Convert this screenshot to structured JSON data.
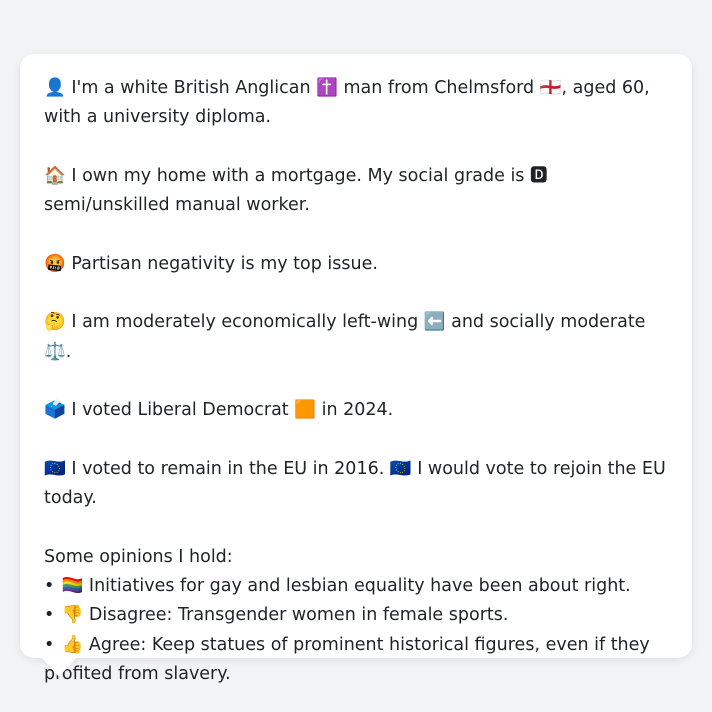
{
  "paragraphs": [
    "👤 I'm a white British Anglican ✝️ man from Chelmsford 🏴󠁧󠁢󠁥󠁮󠁧󠁿, aged 60, with a university diploma.",
    "🏠 I own my home with a mortgage. My social grade is 🅳 semi/unskilled manual worker.",
    "🤬 Partisan negativity is my top issue.",
    "🤔 I am moderately economically left-wing ⬅️ and socially moderate ⚖️.",
    "🗳️ I voted Liberal Democrat 🟧 in 2024.",
    "🇪🇺 I voted to remain in the EU in 2016. 🇪🇺 I would vote to rejoin the EU today."
  ],
  "opinions": {
    "heading": "Some opinions I hold:",
    "bullet": "•",
    "items": [
      "🏳️‍🌈 Initiatives for gay and lesbian equality have been about right.",
      "👎 Disagree: Transgender women in female sports.",
      "👍 Agree: Keep statues of prominent historical figures, even if they profited from slavery."
    ]
  }
}
